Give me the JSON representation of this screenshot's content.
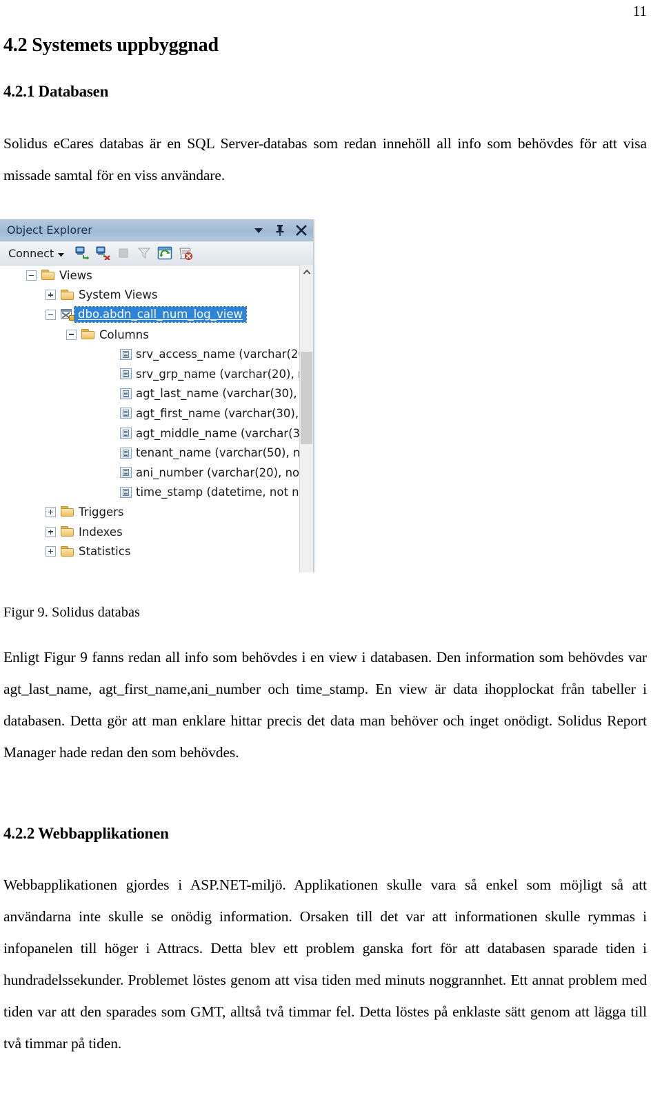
{
  "page": {
    "number": "11"
  },
  "headings": {
    "h1": "4.2 Systemets uppbyggnad",
    "h2_1": "4.2.1 Databasen",
    "h2_2": "4.2.2 Webbapplikationen"
  },
  "paragraphs": {
    "intro": "Solidus eCares databas är en SQL Server-databas som redan innehöll all info som behövdes för att visa missade samtal för en viss användare.",
    "after_figure": "Enligt Figur 9 fanns redan all info som behövdes i en view i databasen. Den information som behövdes var agt_last_name, agt_first_name,ani_number och time_stamp. En view är data ihopplockat från tabeller i databasen. Detta gör att man enklare hittar precis det data man behöver och inget onödigt. Solidus Report Manager hade redan den som behövdes.",
    "webapp": "Webbapplikationen gjordes i ASP.NET-miljö. Applikationen skulle vara så enkel som möjligt så att användarna inte skulle se onödig information. Orsaken till det var att informationen skulle rymmas i infopanelen till höger i Attracs. Detta blev ett problem ganska fort för att databasen sparade tiden i hundradelssekunder. Problemet löstes genom att visa tiden med minuts noggrannhet. Ett annat problem med tiden var att den sparades som GMT, alltså två timmar fel. Detta löstes på enklaste sätt genom att lägga till två timmar på tiden."
  },
  "figure": {
    "caption": "Figur 9. Solidus databas",
    "window": {
      "title": "Object Explorer",
      "titlebar_buttons": [
        {
          "name": "dropdown",
          "glyph": "▼"
        },
        {
          "name": "pin",
          "glyph": "⊥"
        },
        {
          "name": "close",
          "glyph": "✕"
        }
      ],
      "toolbar": {
        "connect_label": "Connect",
        "connect_caret": "▾",
        "icons": [
          "connect-server-icon",
          "disconnect-server-icon",
          "stop-icon",
          "filter-icon",
          "refresh-icon",
          "script-report-icon"
        ]
      },
      "tree": [
        {
          "label": "Views",
          "icon": "folder",
          "indent": 0,
          "expander": "minus",
          "selected": false
        },
        {
          "label": "System Views",
          "icon": "folder",
          "indent": 1,
          "expander": "plus",
          "selected": false
        },
        {
          "label": "dbo.abdn_call_num_log_view",
          "icon": "view",
          "indent": 1,
          "expander": "minus",
          "selected": true
        },
        {
          "label": "Columns",
          "icon": "folder",
          "indent": 2,
          "expander": "minus",
          "selected": false
        },
        {
          "label": "srv_access_name (varchar(20",
          "icon": "column",
          "indent": 3,
          "expander": "none",
          "selected": false
        },
        {
          "label": "srv_grp_name (varchar(20), n",
          "icon": "column",
          "indent": 3,
          "expander": "none",
          "selected": false
        },
        {
          "label": "agt_last_name (varchar(30),",
          "icon": "column",
          "indent": 3,
          "expander": "none",
          "selected": false
        },
        {
          "label": "agt_first_name (varchar(30),",
          "icon": "column",
          "indent": 3,
          "expander": "none",
          "selected": false
        },
        {
          "label": "agt_middle_name (varchar(3",
          "icon": "column",
          "indent": 3,
          "expander": "none",
          "selected": false
        },
        {
          "label": "tenant_name (varchar(50), n",
          "icon": "column",
          "indent": 3,
          "expander": "none",
          "selected": false
        },
        {
          "label": "ani_number (varchar(20), no",
          "icon": "column",
          "indent": 3,
          "expander": "none",
          "selected": false
        },
        {
          "label": "time_stamp (datetime, not n",
          "icon": "column",
          "indent": 3,
          "expander": "none",
          "selected": false
        },
        {
          "label": "Triggers",
          "icon": "folder",
          "indent": 1,
          "expander": "plus",
          "selected": false
        },
        {
          "label": "Indexes",
          "icon": "folder",
          "indent": 1,
          "expander": "plus",
          "selected": false
        },
        {
          "label": "Statistics",
          "icon": "folder",
          "indent": 1,
          "expander": "plus",
          "selected": false
        }
      ],
      "scrollbar": {
        "up_arrow": "⌃"
      }
    }
  },
  "colors": {
    "selection_blue": "#2e84d8",
    "titlebar_blue": "#a6bed6",
    "folder_gold": "#f0c36d",
    "page_background": "#ffffff"
  }
}
